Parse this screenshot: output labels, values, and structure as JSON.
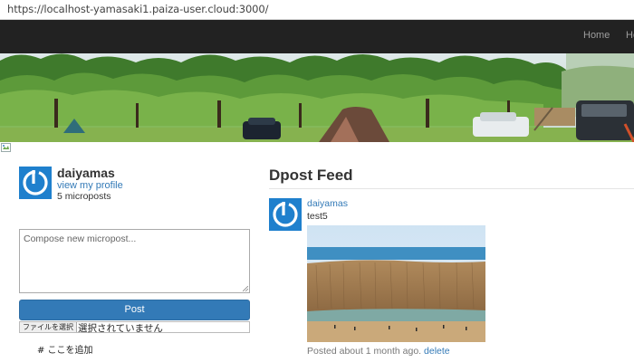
{
  "browser": {
    "url": "https://localhost-yamasaki1.paiza-user.cloud:3000/"
  },
  "navbar": {
    "links": [
      "Home",
      "He"
    ]
  },
  "user": {
    "name": "daiyamas",
    "profile_link": "view my profile",
    "micropost_count": "5 microposts"
  },
  "compose": {
    "placeholder": "Compose new micropost...",
    "value": "",
    "post_label": "Post",
    "file_button": "ファイルを選択",
    "file_status": "選択されていません",
    "add_here": "# ここを追加"
  },
  "feed": {
    "title": "Dpost Feed",
    "posts": [
      {
        "user": "daiyamas",
        "content": "test5",
        "posted": "Posted about 1 month ago.",
        "delete_label": "delete"
      }
    ]
  },
  "colors": {
    "navbar": "#222222",
    "link": "#337ab7",
    "primary": "#337ab7",
    "gravatar": "#1f80cd"
  },
  "icons": [
    "gravatar-icon",
    "broken-image-icon",
    "resize-grip-icon"
  ]
}
